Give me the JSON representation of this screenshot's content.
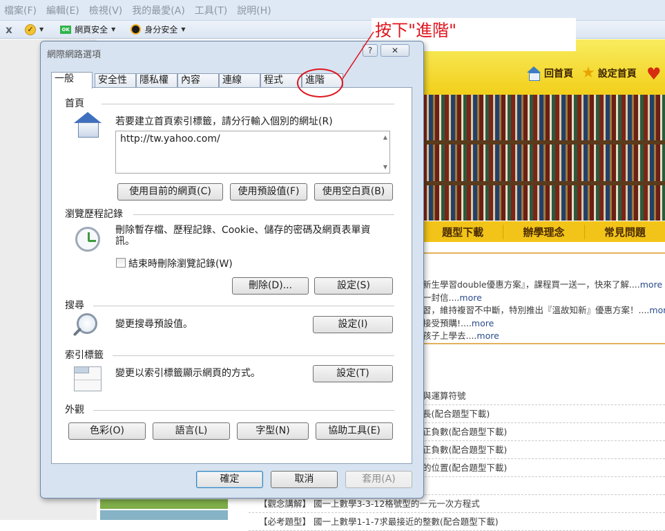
{
  "menubar": [
    "檔案(F)",
    "編輯(E)",
    "檢視(V)",
    "我的最愛(A)",
    "工具(T)",
    "說明(H)"
  ],
  "toolbar": {
    "close_glyph": "x",
    "items": [
      {
        "label": ""
      },
      {
        "label": "網頁安全",
        "badge": "OK"
      },
      {
        "label": "身分安全"
      }
    ]
  },
  "background_page": {
    "home_link": "回首頁",
    "set_home_link": "設定首頁",
    "nav": [
      "題型下載",
      "辦學理念",
      "常見問題"
    ],
    "news": [
      {
        "text": "新生學習double優惠方案』，課程買一送一，快來了解....",
        "more": "more"
      },
      {
        "text": "一封信....",
        "more": "more"
      },
      {
        "text": "習，維持複習不中斷，特別推出『溫故知新』優惠方案！....",
        "more": "more"
      },
      {
        "text": "接受預購!....",
        "more": "more"
      },
      {
        "text": "孩子上學去....",
        "more": "more"
      }
    ],
    "list": [
      "與運算符號",
      "長(配合題型下載)",
      "正負數(配合題型下載)",
      "正負數(配合題型下載)",
      "的位置(配合題型下載)",
      "",
      "【觀念講解】 國一上數學3-3-12格號型的一元一次方程式",
      "【必考題型】 國一上數學1-1-7求最接近的整數(配合題型下載)"
    ]
  },
  "callout": {
    "text": "按下\"進階\""
  },
  "dialog": {
    "title": "網際網路選項",
    "help_glyph": "?",
    "tabs": [
      "一般",
      "安全性",
      "隱私權",
      "內容",
      "連線",
      "程式",
      "進階"
    ],
    "active_tab": "一般",
    "homepage": {
      "label": "首頁",
      "instruction": "若要建立首頁索引標籤，請分行輸入個別的網址(R)",
      "url": "http://tw.yahoo.com/",
      "buttons": [
        "使用目前的網頁(C)",
        "使用預設值(F)",
        "使用空白頁(B)"
      ]
    },
    "history": {
      "label": "瀏覽歷程記錄",
      "description": "刪除暫存檔、歷程記錄、Cookie、儲存的密碼及網頁表單資訊。",
      "checkbox_label": "結束時刪除瀏覽記錄(W)",
      "checkbox_checked": false,
      "buttons": [
        "刪除(D)...",
        "設定(S)"
      ]
    },
    "search": {
      "label": "搜尋",
      "description": "變更搜尋預設值。",
      "button": "設定(I)"
    },
    "tabs_section": {
      "label": "索引標籤",
      "description": "變更以索引標籤顯示網頁的方式。",
      "button": "設定(T)"
    },
    "appearance": {
      "label": "外觀",
      "buttons": [
        "色彩(O)",
        "語言(L)",
        "字型(N)",
        "協助工具(E)"
      ]
    },
    "footer": {
      "ok": "確定",
      "cancel": "取消",
      "apply": "套用(A)"
    }
  },
  "colors": {
    "callout_red": "#e0141e",
    "dialog_frame": "#d7e3f1",
    "page_yellow": "#f2c419"
  }
}
